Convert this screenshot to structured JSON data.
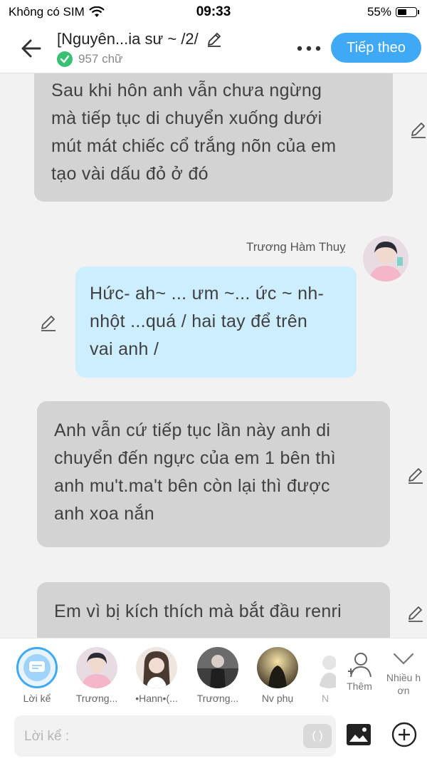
{
  "status_bar": {
    "carrier": "Không có SIM",
    "time": "09:33",
    "battery": "55%",
    "battery_level": 0.55
  },
  "header": {
    "title": "[Nguyên...ia sư ~ /2/",
    "word_count": "957 chữ",
    "next_button": "Tiếp theo"
  },
  "messages": [
    {
      "type": "narration",
      "lines": [
        "Sau khi hôn anh vẫn chưa ngừng",
        "mà tiếp tục di chuyển xuống dưới",
        "mút mát chiếc cổ trắng nõn của em",
        "tạo vài dấu đỏ ở đó"
      ]
    },
    {
      "type": "character",
      "sender": "Trương Hàm Thuỵ",
      "lines": [
        "Hức- ah~ ... ưm ~... ức ~ nh-",
        "nhột ...quá / hai tay để trên",
        "vai anh /"
      ]
    },
    {
      "type": "narration",
      "lines": [
        "Anh vẫn cứ tiếp tục lần này anh di",
        "chuyển đến ngực của em 1 bên thì",
        "anh mu't.ma't bên còn lại thì được",
        "anh xoa nắn"
      ]
    },
    {
      "type": "narration",
      "lines": [
        "Em vì bị kích thích mà bắt đầu renri"
      ]
    }
  ],
  "character_bar": {
    "items": [
      {
        "label": "Lời kể",
        "color": "#9fd3f7"
      },
      {
        "label": "Trương...",
        "color": "#c9a6b8"
      },
      {
        "label": "•Hann•(...",
        "color": "#d8b9a8"
      },
      {
        "label": "Trương...",
        "color": "#5c5c5c"
      },
      {
        "label": "Nv phụ",
        "color": "#b8a070"
      },
      {
        "label": "N",
        "color": "#cfcfcf"
      }
    ],
    "add_label": "Thêm",
    "more_label_1": "Nhiều h",
    "more_label_2": "ơn"
  },
  "composer": {
    "placeholder": "Lời kể :",
    "paren_button": "( )"
  }
}
